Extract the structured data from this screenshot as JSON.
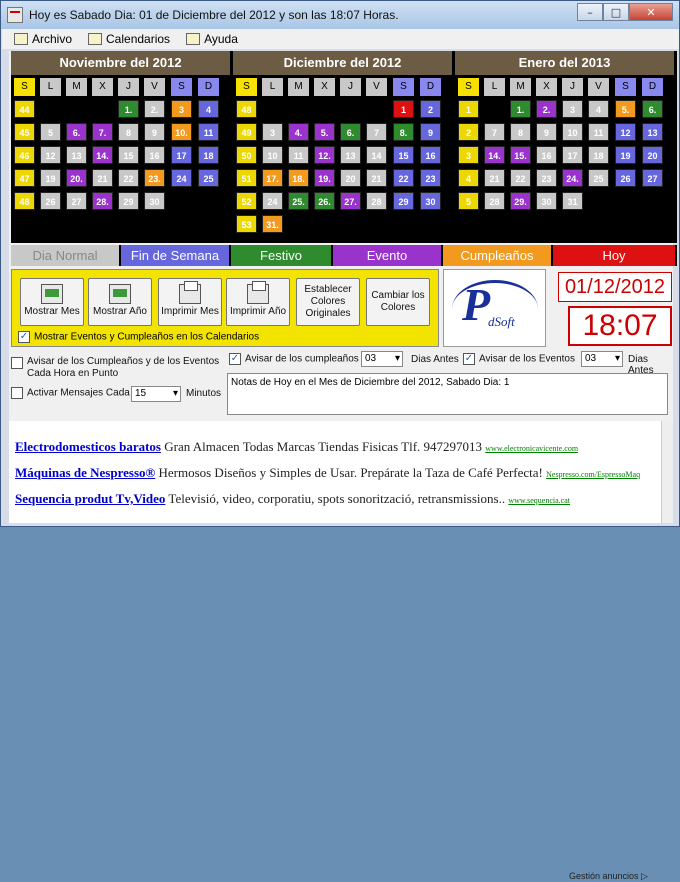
{
  "title": "Hoy es Sabado Dia: 01 de Diciembre del 2012 y son las 18:07 Horas.",
  "window_buttons": {
    "minimize": "–",
    "maximize": "□",
    "close": "✕"
  },
  "menu": {
    "archivo": "Archivo",
    "calendarios": "Calendarios",
    "ayuda": "Ayuda"
  },
  "dow": [
    "S",
    "L",
    "M",
    "X",
    "J",
    "V",
    "S",
    "D"
  ],
  "dow_colors": [
    "#f5e000",
    "#c8c8c8",
    "#c8c8c8",
    "#c8c8c8",
    "#c8c8c8",
    "#c8c8c8",
    "#8888ee",
    "#8888ee"
  ],
  "color_map": {
    "y": "#ecd800",
    "g": "#c8c8c8",
    "b": "#6666dd",
    "p": "#9933cc",
    "o": "#f19a1f",
    "gr": "#2e8b2e",
    "r": "#dd1111",
    "n": "#000000"
  },
  "calendars": [
    {
      "title": "Noviembre del 2012",
      "rows": [
        [
          "44",
          "",
          "",
          "",
          "1.",
          "2.",
          "3",
          "4"
        ],
        [
          "45",
          "5",
          "6.",
          "7.",
          "8",
          "9",
          "10.",
          "11"
        ],
        [
          "46",
          "12",
          "13",
          "14.",
          "15",
          "16",
          "17",
          "18"
        ],
        [
          "47",
          "19",
          "20.",
          "21",
          "22",
          "23.",
          "24",
          "25"
        ],
        [
          "48",
          "26",
          "27",
          "28.",
          "29",
          "30",
          "",
          ""
        ]
      ],
      "colors": [
        [
          "y",
          "n",
          "n",
          "n",
          "gr",
          "g",
          "o",
          "b"
        ],
        [
          "y",
          "g",
          "p",
          "p",
          "g",
          "g",
          "o",
          "b"
        ],
        [
          "y",
          "g",
          "g",
          "p",
          "g",
          "g",
          "b",
          "b"
        ],
        [
          "y",
          "g",
          "p",
          "g",
          "g",
          "o",
          "b",
          "b"
        ],
        [
          "y",
          "g",
          "g",
          "p",
          "g",
          "g",
          "n",
          "n"
        ]
      ]
    },
    {
      "title": "Diciembre del 2012",
      "rows": [
        [
          "48",
          "",
          "",
          "",
          "",
          "",
          "1",
          "2"
        ],
        [
          "49",
          "3",
          "4.",
          "5.",
          "6.",
          "7",
          "8.",
          "9"
        ],
        [
          "50",
          "10",
          "11",
          "12.",
          "13",
          "14",
          "15",
          "16"
        ],
        [
          "51",
          "17.",
          "18.",
          "19.",
          "20",
          "21",
          "22",
          "23"
        ],
        [
          "52",
          "24",
          "25.",
          "26.",
          "27.",
          "28",
          "29",
          "30"
        ],
        [
          "53",
          "31.",
          "",
          "",
          "",
          "",
          "",
          ""
        ]
      ],
      "colors": [
        [
          "y",
          "n",
          "n",
          "n",
          "n",
          "n",
          "r",
          "b"
        ],
        [
          "y",
          "g",
          "p",
          "p",
          "gr",
          "g",
          "gr",
          "b"
        ],
        [
          "y",
          "g",
          "g",
          "p",
          "g",
          "g",
          "b",
          "b"
        ],
        [
          "y",
          "o",
          "o",
          "p",
          "g",
          "g",
          "b",
          "b"
        ],
        [
          "y",
          "g",
          "gr",
          "gr",
          "p",
          "g",
          "b",
          "b"
        ],
        [
          "y",
          "o",
          "n",
          "n",
          "n",
          "n",
          "n",
          "n"
        ]
      ]
    },
    {
      "title": "Enero del 2013",
      "rows": [
        [
          "1",
          "",
          "1.",
          "2.",
          "3",
          "4",
          "5.",
          "6."
        ],
        [
          "2",
          "7",
          "8",
          "9",
          "10",
          "11",
          "12",
          "13"
        ],
        [
          "3",
          "14.",
          "15.",
          "16",
          "17",
          "18",
          "19",
          "20"
        ],
        [
          "4",
          "21",
          "22",
          "23",
          "24.",
          "25",
          "26",
          "27"
        ],
        [
          "5",
          "28",
          "29.",
          "30",
          "31",
          "",
          "",
          ""
        ]
      ],
      "colors": [
        [
          "y",
          "n",
          "gr",
          "p",
          "g",
          "g",
          "o",
          "gr"
        ],
        [
          "y",
          "g",
          "g",
          "g",
          "g",
          "g",
          "b",
          "b"
        ],
        [
          "y",
          "p",
          "p",
          "g",
          "g",
          "g",
          "b",
          "b"
        ],
        [
          "y",
          "g",
          "g",
          "g",
          "p",
          "g",
          "b",
          "b"
        ],
        [
          "y",
          "g",
          "p",
          "g",
          "g",
          "n",
          "n",
          "n"
        ]
      ]
    }
  ],
  "legend": [
    {
      "label": "Dia Normal",
      "color": "#c8c8c8",
      "text": "#888888"
    },
    {
      "label": "Fin de Semana",
      "color": "#6666dd",
      "text": "#ffffff"
    },
    {
      "label": "Festivo",
      "color": "#2e8b2e",
      "text": "#ffffff"
    },
    {
      "label": "Evento",
      "color": "#9933cc",
      "text": "#ffffff"
    },
    {
      "label": "Cumpleaños",
      "color": "#f19a1f",
      "text": "#ffffff"
    },
    {
      "label": "Hoy",
      "color": "#dd1111",
      "text": "#ffffff"
    }
  ],
  "buttons": {
    "mostrar_mes": "Mostrar Mes",
    "mostrar_ano": "Mostrar Año",
    "imprimir_mes": "Imprimir Mes",
    "imprimir_ano": "Imprimir Año",
    "establecer": "Establecer Colores Originales",
    "cambiar": "Cambiar los Colores"
  },
  "mostrar_eventos": "Mostrar Eventos y Cumpleaños en los Calendarios",
  "logo": {
    "p": "P",
    "soft": "dSoft"
  },
  "date": "01/12/2012",
  "time": "18:07",
  "opts": {
    "avisar_hora": "Avisar de los Cumpleaños y de los Eventos Cada Hora en Punto",
    "activar": "Activar Mensajes Cada",
    "activar_val": "15",
    "minutos": "Minutos",
    "avisar_cumple": "Avisar de los cumpleaños",
    "cumple_val": "03",
    "dias_antes": "Dias Antes",
    "avisar_eventos": "Avisar de los Eventos",
    "eventos_val": "03"
  },
  "notes": "Notas de Hoy en el Mes de Diciembre del 2012, Sabado Dia: 1",
  "ads": [
    {
      "head": "Electrodomesticos baratos",
      "desc": "Gran Almacen Todas Marcas Tiendas Fisicas Tlf. 947297013",
      "url": "www.electronicavicente.com"
    },
    {
      "head": "Máquinas de Nespresso®",
      "desc": "Hermosos Diseños y Simples de Usar. Prepárate la Taza de Café Perfecta!",
      "url": "Nespresso.com/EspressoMaq"
    },
    {
      "head": "Sequencia produt Tv,Video",
      "desc": "Televisió, video, corporatiu, spots sonorització, retransmissions..",
      "url": "www.sequencia.cat"
    }
  ],
  "gestion": "Gestión anuncios ▷"
}
